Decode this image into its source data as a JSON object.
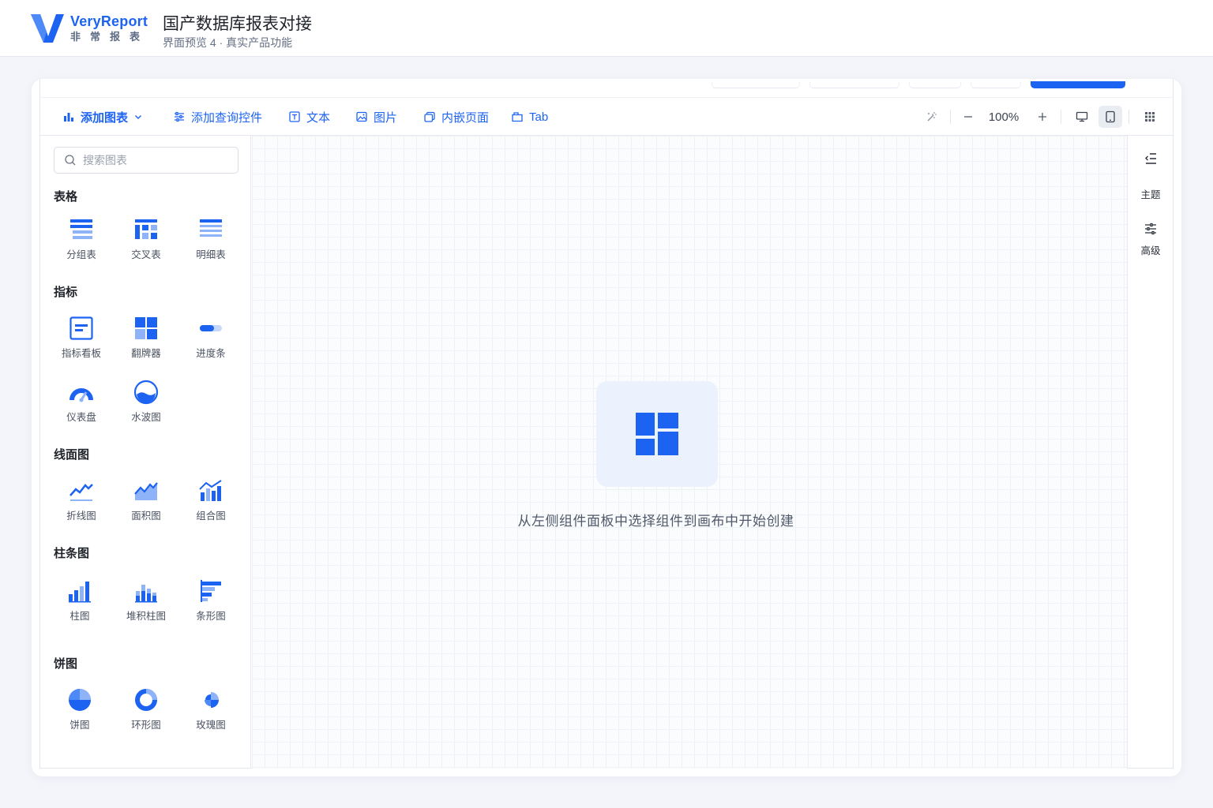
{
  "header": {
    "brand_name": "VeryReport",
    "brand_sub": "非常报表",
    "title": "国产数据库报表对接",
    "subtitle": "界面预览 4 · 真实产品功能"
  },
  "toolbar": {
    "add_chart": "添加图表",
    "add_query": "添加查询控件",
    "text": "文本",
    "image": "图片",
    "embed_page": "内嵌页面",
    "tab": "Tab",
    "zoom": "100%"
  },
  "search": {
    "placeholder": "搜索图表"
  },
  "sections": {
    "table": "表格",
    "indicator": "指标",
    "line": "线面图",
    "bar": "柱条图",
    "pie": "饼图"
  },
  "widgets": {
    "group_table": "分组表",
    "cross_table": "交叉表",
    "detail_table": "明细表",
    "kpi_board": "指标看板",
    "flip_card": "翻牌器",
    "progress": "进度条",
    "gauge": "仪表盘",
    "liquid": "水波图",
    "line_chart": "折线图",
    "area_chart": "面积图",
    "combo_chart": "组合图",
    "bar_chart": "柱图",
    "stacked_bar": "堆积柱图",
    "hbar_chart": "条形图",
    "pie_chart": "饼图",
    "donut_chart": "环形图",
    "rose_chart": "玫瑰图"
  },
  "canvas": {
    "empty_text": "从左侧组件面板中选择组件到画布中开始创建"
  },
  "rail": {
    "theme": "主题",
    "advanced": "高级"
  },
  "colors": {
    "accent": "#1d63f2",
    "accent_light": "#8fb3f8"
  }
}
